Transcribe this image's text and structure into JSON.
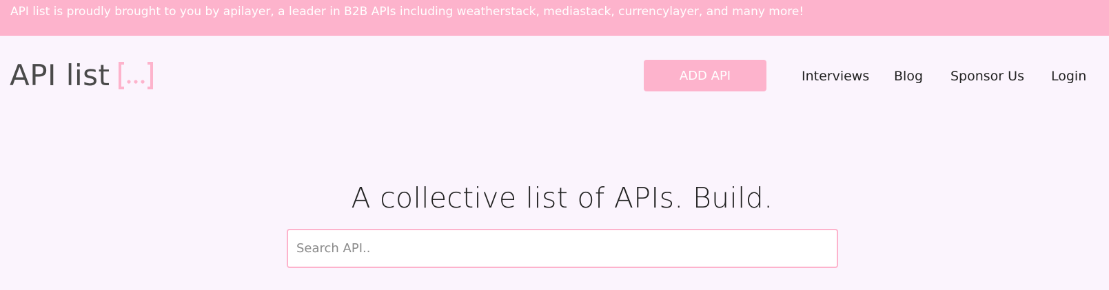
{
  "banner": {
    "text": "API list is proudly brought to you by apilayer, a leader in B2B APIs including weatherstack, mediastack, currencylayer, and many more!"
  },
  "header": {
    "logo_text": "API list",
    "logo_icon": "bracket-ellipsis-icon",
    "add_api_label": "ADD API",
    "nav": {
      "interviews": "Interviews",
      "blog": "Blog",
      "sponsor": "Sponsor Us",
      "login": "Login"
    }
  },
  "hero": {
    "title": "A collective list of APIs. Build."
  },
  "search": {
    "placeholder": "Search API..",
    "value": ""
  },
  "colors": {
    "accent": "#fdb3cc",
    "background": "#fbf4fd",
    "text": "#222222",
    "logo_text": "#4a4a4a"
  }
}
